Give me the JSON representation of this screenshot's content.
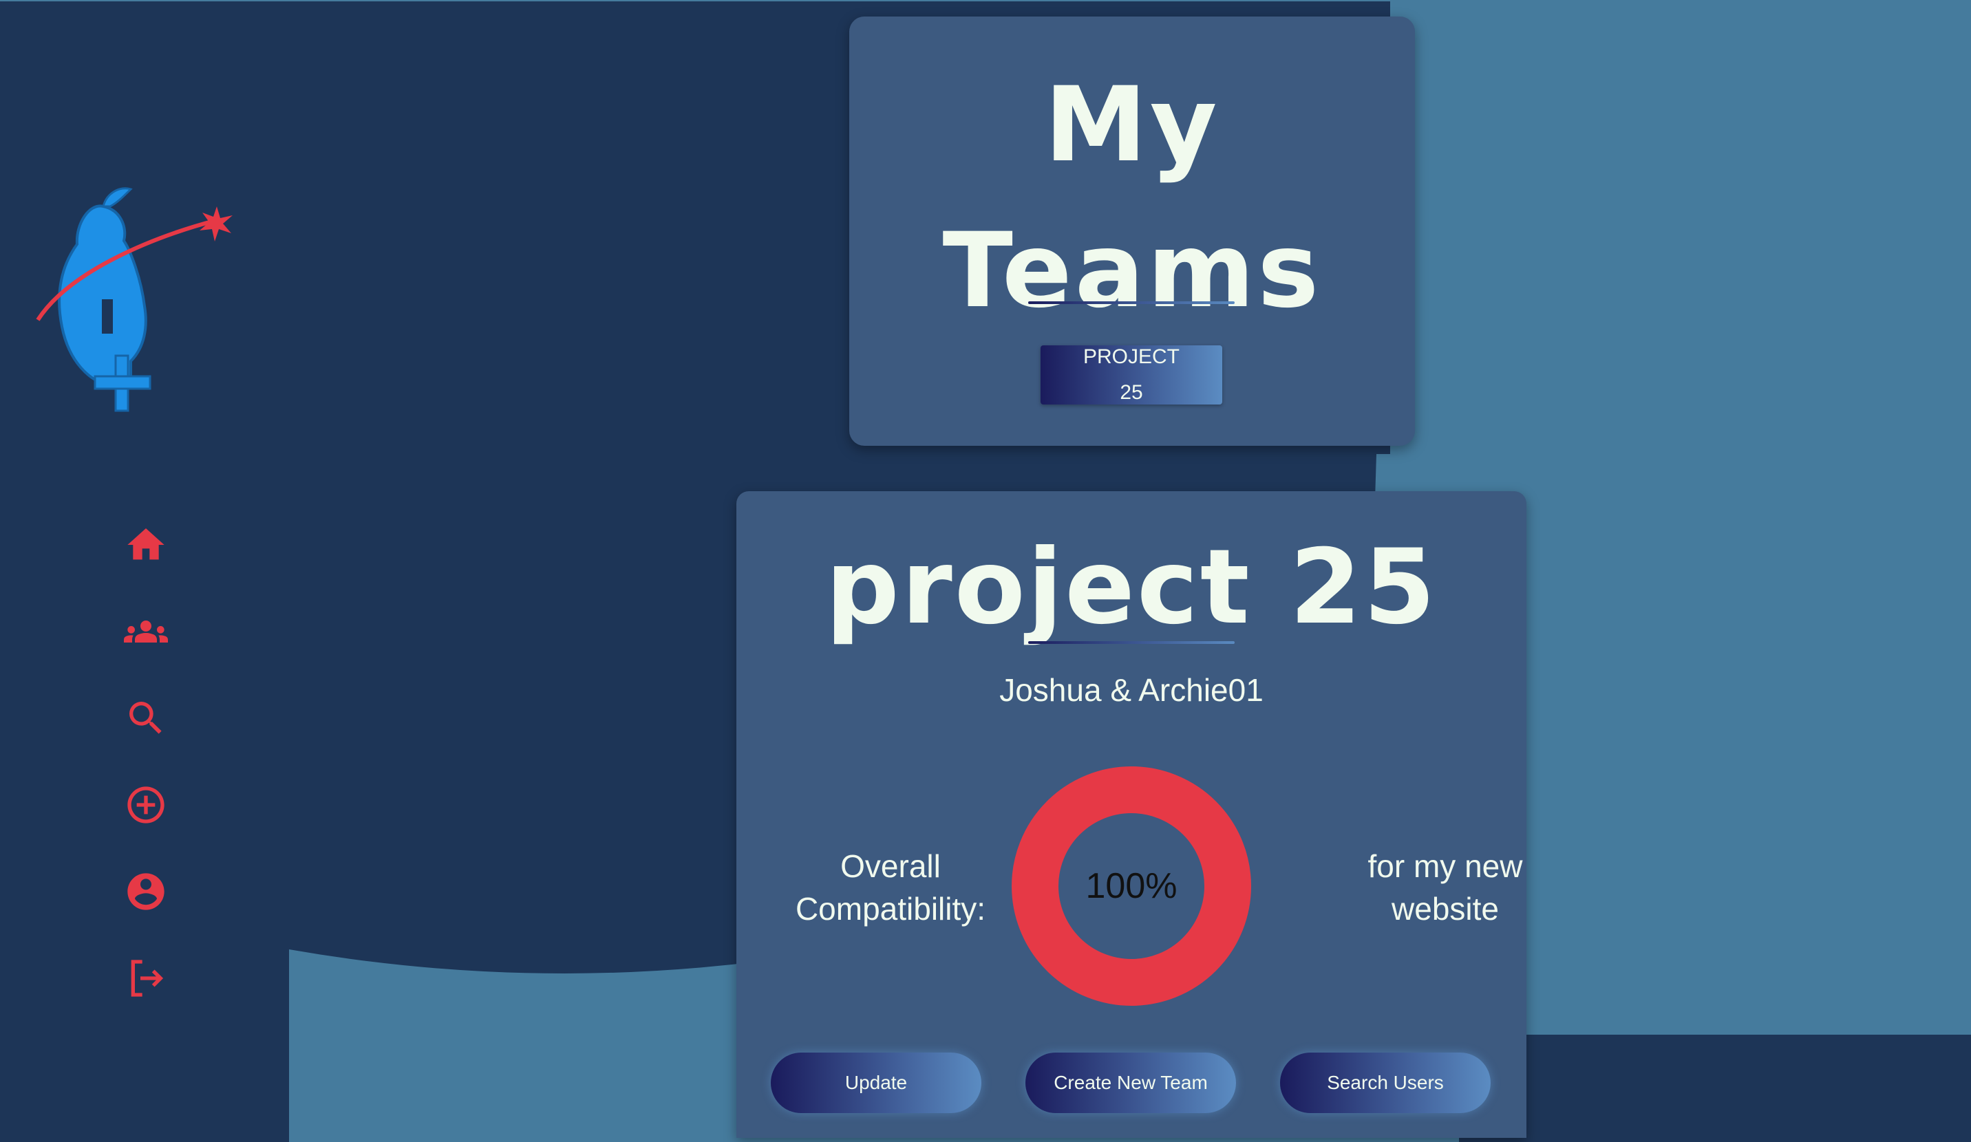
{
  "colors": {
    "background_dark": "#1d3557",
    "background_light": "#457b9d",
    "card": "#3d5a80",
    "accent": "#e63946",
    "text": "#f1faee"
  },
  "sidebar": {
    "logo": "pear-plus-logo",
    "items": [
      {
        "icon": "home-icon"
      },
      {
        "icon": "group-icon"
      },
      {
        "icon": "search-icon"
      },
      {
        "icon": "add-circle-icon"
      },
      {
        "icon": "account-icon"
      },
      {
        "icon": "logout-icon"
      }
    ]
  },
  "my_teams": {
    "title_line1": "My",
    "title_line2": "Teams",
    "teams": [
      {
        "line1": "PROJECT",
        "line2": "25"
      }
    ]
  },
  "team_detail": {
    "name": "project 25",
    "members": "Joshua & Archie01",
    "compatibility_label_line1": "Overall",
    "compatibility_label_line2": "Compatibility:",
    "compatibility_percent": "100%",
    "compatibility_value": 1.0,
    "description_line1": "for my new",
    "description_line2": "website",
    "buttons": {
      "update": "Update",
      "create": "Create New Team",
      "search": "Search Users"
    }
  }
}
